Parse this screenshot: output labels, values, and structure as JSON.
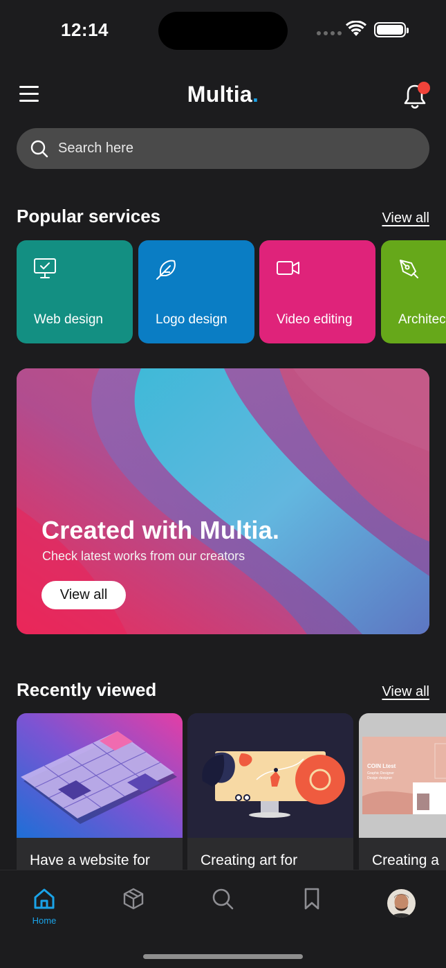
{
  "status_bar": {
    "time": "12:14"
  },
  "header": {
    "brand": "Multia",
    "brand_dot": "."
  },
  "search": {
    "placeholder": "Search here"
  },
  "popular": {
    "title": "Popular services",
    "view_all": "View all",
    "items": [
      {
        "label": "Web design",
        "icon": "monitor-check-icon",
        "color": "#138f82"
      },
      {
        "label": "Logo design",
        "icon": "feather-icon",
        "color": "#0a7dc4"
      },
      {
        "label": "Video editing",
        "icon": "video-camera-icon",
        "color": "#df237a"
      },
      {
        "label": "Architecture",
        "icon": "pen-tool-icon",
        "color": "#66a81a"
      }
    ]
  },
  "banner": {
    "title": "Created with Multia.",
    "subtitle": "Check latest works from our creators",
    "button": "View all"
  },
  "recent": {
    "title": "Recently viewed",
    "view_all": "View all",
    "items": [
      {
        "title": "Have a website for"
      },
      {
        "title": "Creating art for"
      },
      {
        "title": "Creating a"
      }
    ],
    "third_thumb": {
      "heading": "COIN Ltest",
      "line1": "Graphic Designer",
      "line2": "Design designer"
    }
  },
  "tabbar": {
    "items": [
      {
        "label": "Home",
        "icon": "home-icon",
        "active": true
      },
      {
        "label": "",
        "icon": "box-icon",
        "active": false
      },
      {
        "label": "",
        "icon": "search-icon",
        "active": false
      },
      {
        "label": "",
        "icon": "bookmark-icon",
        "active": false
      },
      {
        "label": "",
        "icon": "avatar",
        "active": false
      }
    ],
    "active_color": "#1aa3e8"
  }
}
